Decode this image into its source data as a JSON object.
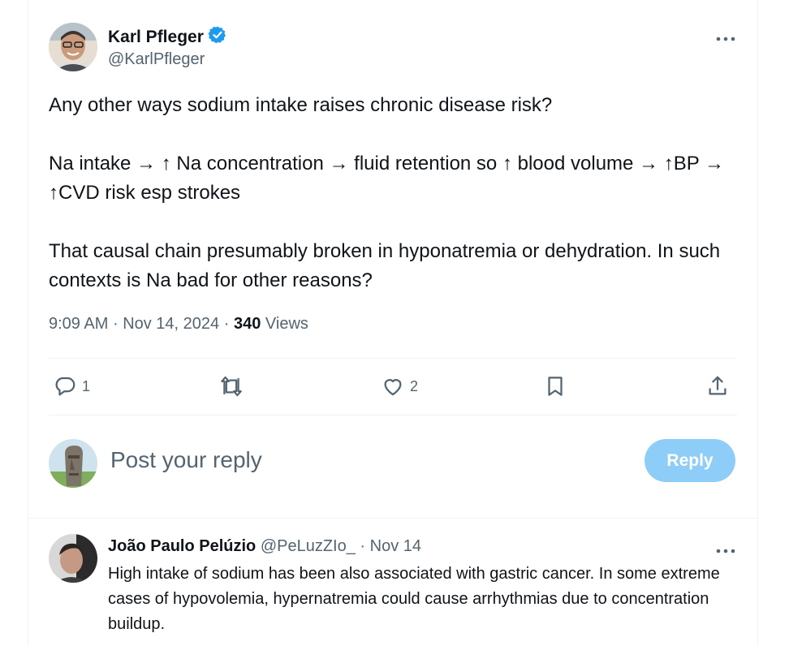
{
  "tweet": {
    "author_name": "Karl Pfleger",
    "author_handle": "@KarlPfleger",
    "verified_icon": "verified-badge-icon",
    "more_icon": "more-icon",
    "text": "Any other ways sodium intake raises chronic disease risk?\n\nNa intake → ↑ Na concentration → fluid retention so ↑ blood volume → ↑BP → ↑CVD risk esp strokes\n\nThat causal chain presumably broken in hyponatremia or dehydration. In such contexts is Na bad for other reasons?",
    "time": "9:09 AM",
    "sep1": "·",
    "date": "Nov 14, 2024",
    "sep2": "·",
    "views_count": "340",
    "views_label": "Views"
  },
  "actions": {
    "reply_count": "1",
    "like_count": "2",
    "icons": [
      "reply-icon",
      "retweet-icon",
      "like-icon",
      "bookmark-icon",
      "share-icon"
    ]
  },
  "composer": {
    "placeholder": "Post your reply",
    "button_label": "Reply",
    "button_color": "#8ecdf8"
  },
  "reply": {
    "author_name": "João Paulo Pelúzio",
    "author_handle": "@PeLuzZIo_",
    "sep": "·",
    "date": "Nov 14",
    "text": "High intake of sodium has been also associated with gastric cancer. In some extreme cases of hypovolemia, hypernatremia could cause arrhythmias due to concentration buildup."
  },
  "colors": {
    "text": "#0f1419",
    "muted": "#536471",
    "verified": "#1d9bf0",
    "divider": "#eff3f4"
  }
}
